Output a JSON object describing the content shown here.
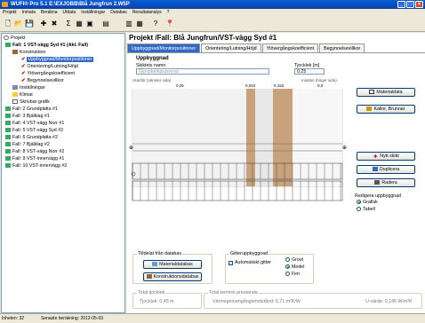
{
  "window": {
    "title": "WUFI® Pro 5.1   E:\\EXJOBB\\Blå Jungfrun 2.W5P"
  },
  "menu": [
    "Projekt",
    "Inmata",
    "Beräkna",
    "Utdata",
    "Inställningar",
    "Databas",
    "Resultatanalys",
    "?"
  ],
  "tree": {
    "root": "Projekt",
    "case1": "Fall: 1 VST-vägg Syd #1 (Akt. Fall)",
    "construction": "Konstruktion",
    "items": [
      "Uppbyggnad/Monitorpositioner",
      "Orientering/Lutning/Höjd",
      "Ytövergångskoefficient",
      "Begynnelsevillkor"
    ],
    "settings": "Inställningar",
    "climate": "Klimat",
    "timestep": "Skrivbar grafik",
    "cases": [
      "Fall: 2 Grundplatta #1",
      "Fall: 3 Bjälklag #1",
      "Fall: 4 VST-vägg Norr #1",
      "Fall: 5 VST-vägg Syd #2",
      "Fall: 6 Grundplatta #2",
      "Fall: 7 Bjälklag #2",
      "Fall: 8 VST-vägg Norr #2",
      "Fall: 9 VST-innervägg #1",
      "Fall: 10 VST-innervägg #2"
    ]
  },
  "main": {
    "title": "Projekt /Fall:  Blå Jungfrun/VST-vägg Syd #1",
    "tabs": [
      "Uppbyggnad/Monitorpositioner",
      "Orientering/Lutning/Höjd",
      "Ytövergångskoefficient",
      "Begynnelsevillkor"
    ],
    "section": "Uppbyggnad",
    "material_name_label": "Skiktets namn",
    "material_name_value": "Gipsplankpuprerad",
    "thickness_label": "Tjocklek [m]",
    "thickness_value": "0,25",
    "exterior_label": "Utanför (vänster sida)",
    "interior_label": "Insidan (höger sida)",
    "scale": [
      "0,25",
      "0,024",
      "0,152",
      "0,0"
    ],
    "buttons": {
      "material_data": "Materialdata",
      "sources": "Källor, Brunnar",
      "new_layer": "Nytt skikt",
      "duplicate": "Duplicera",
      "delete": "Radera"
    },
    "edit_group": {
      "title": "Redigera uppbyggnad",
      "options": [
        "Grafisk",
        "Tabell"
      ],
      "selected": "Grafisk"
    },
    "db_group": {
      "title": "Tilldelat från databas",
      "btn1": "Materialdatabas",
      "btn2": "Konstruktionsdatabas"
    },
    "grid_group": {
      "title": "Gitteruppbyggnad",
      "auto": "Automatiskt gitter",
      "options": [
        "Grovt",
        "Medel",
        "Fint"
      ],
      "selected": "Medel"
    },
    "totals": {
      "thickness_title": "Total tjocklek",
      "thickness_value": "Tjocklek: 0,45 m",
      "thermal_title": "Total termisk prestanda",
      "resistance": "Värmegenomgångsmotstånd: 6,71 m²K/W",
      "uvalue": "U-värde: 0,145 W/m²K"
    }
  },
  "status": {
    "left": "Inheten: 32",
    "right": "Senaste beräkning: 2012-05-03"
  },
  "colors": {
    "selection": "#316ac5",
    "brown": "#c8a27c",
    "plaster": "#d9d9d9"
  }
}
